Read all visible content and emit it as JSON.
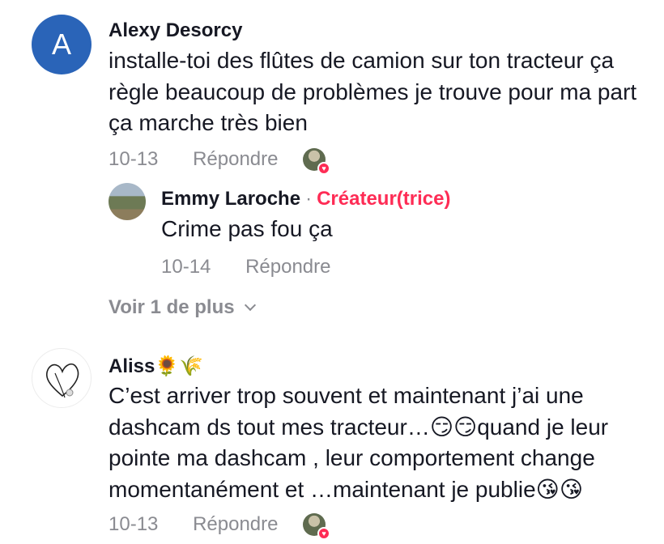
{
  "comments": [
    {
      "author": "Alexy Desorcy",
      "avatar_letter": "A",
      "text": "installe-toi des flûtes de camion sur ton tracteur ça règle beaucoup de problèmes je trouve pour ma part ça marche très bien",
      "date": "10-13",
      "reply_label": "Répondre",
      "replies": [
        {
          "author": "Emmy Laroche",
          "separator": "·",
          "badge": "Créateur(trice)",
          "text": "Crime pas fou ça",
          "date": "10-14",
          "reply_label": "Répondre"
        }
      ],
      "view_more": "Voir 1 de plus"
    },
    {
      "author": "Aliss🌻🌾",
      "text": "C’est arriver trop souvent et maintenant j’ai une dashcam ds tout mes tracteur…😏😏quand je leur pointe ma dashcam , leur comportement change momentanément et …maintenant je publie😘😘",
      "date": "10-13",
      "reply_label": "Répondre"
    }
  ],
  "icons": {
    "creator_liked_badge": "heart-icon",
    "view_more_chevron": "chevron-down-icon"
  },
  "colors": {
    "accent": "#fe2c55",
    "secondary_text": "#8a8b91",
    "avatar_a_bg": "#2a64b8"
  }
}
